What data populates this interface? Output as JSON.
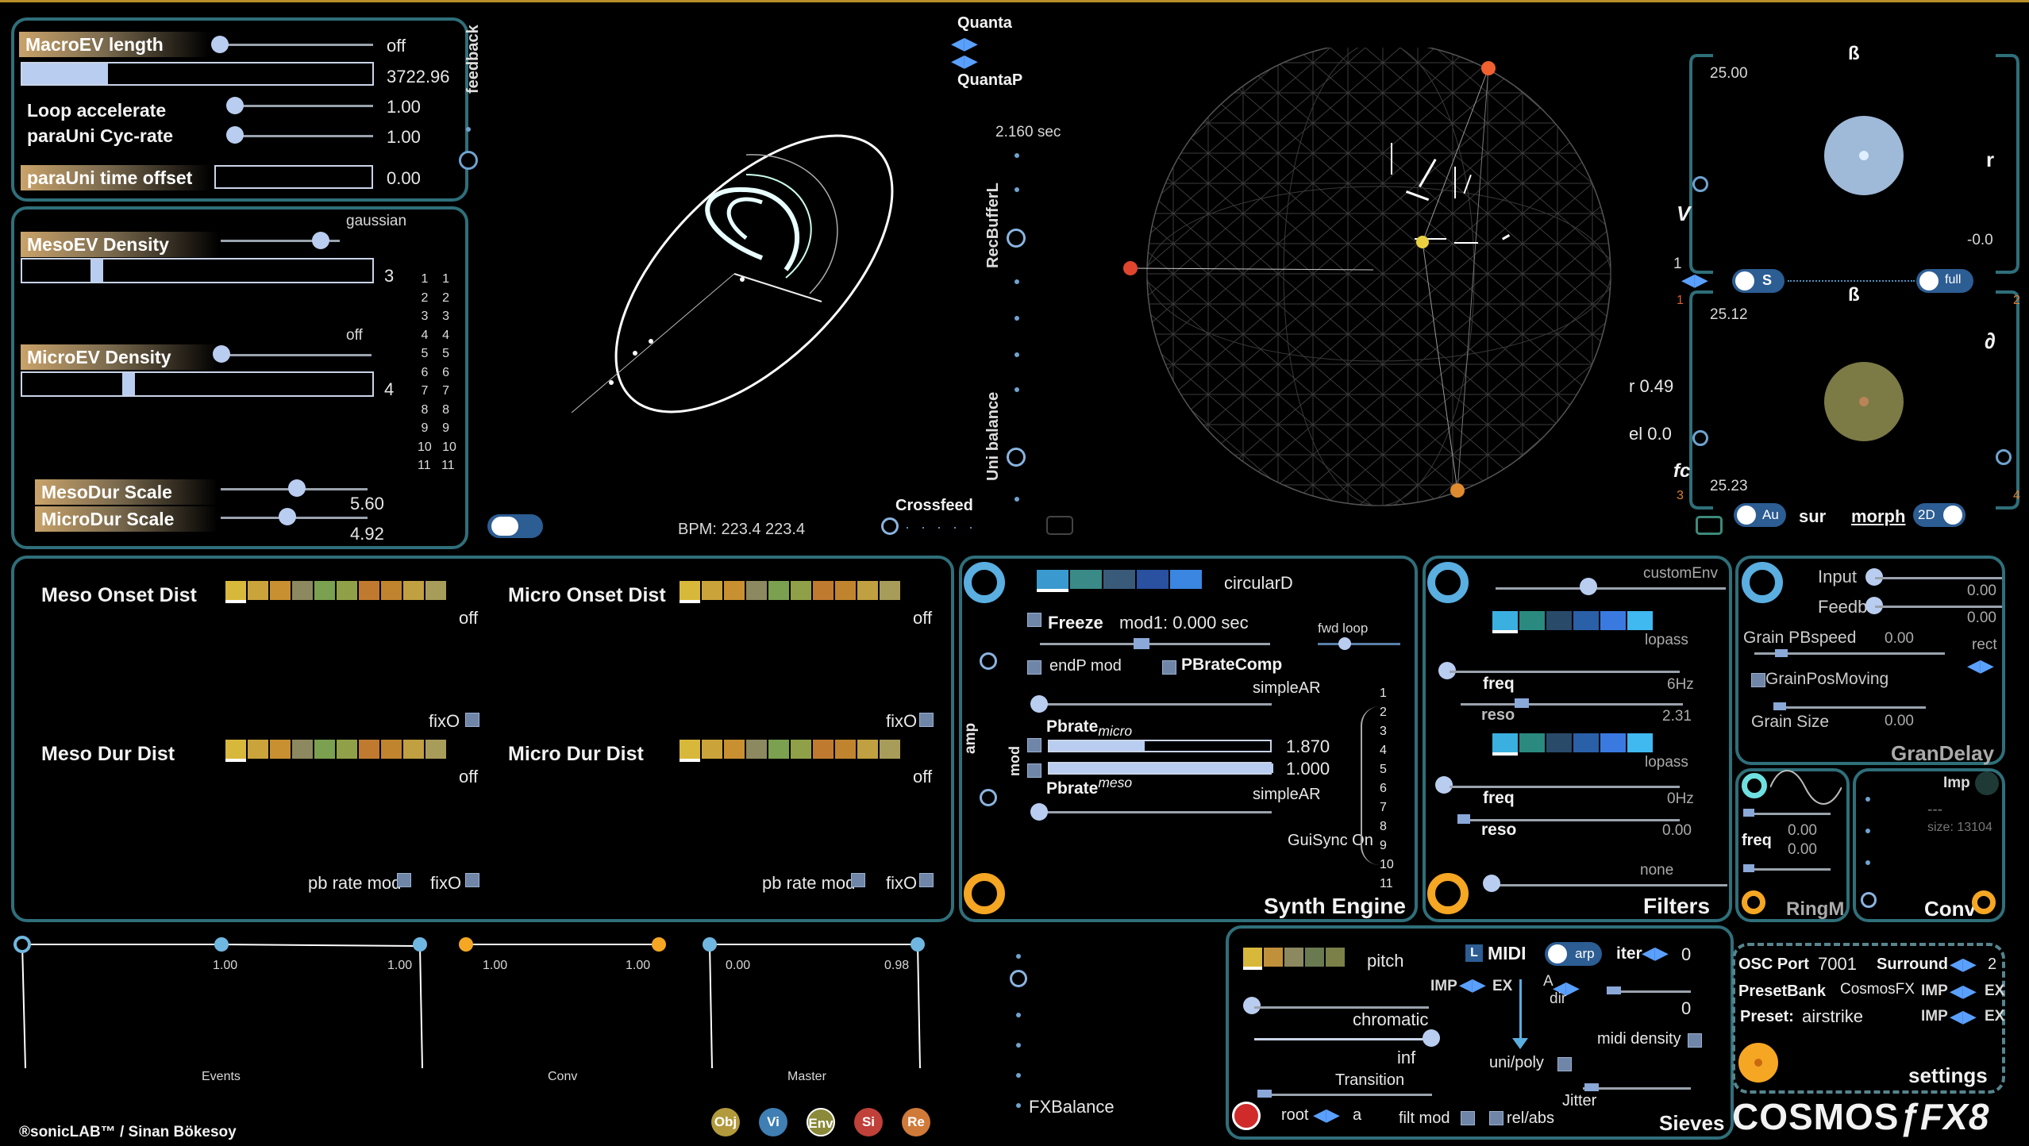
{
  "top": {
    "macroev_label": "MacroEV length",
    "macroev_state": "off",
    "macroev_value": "3722.96",
    "feedback_label": "feedback",
    "loop_accelerate_label": "Loop  accelerate",
    "loop_accelerate_value": "1.00",
    "parauni_cycrate_label": "paraUni  Cyc-rate",
    "parauni_cycrate_value": "1.00",
    "parauni_offset_label": "paraUni time offset",
    "parauni_offset_value": "0.00"
  },
  "density": {
    "meso_label": "MesoEV   Density",
    "meso_dist": "gaussian",
    "meso_value": "3",
    "micro_label": "MicroEV   Density",
    "micro_state": "off",
    "micro_value": "4",
    "meso_dur_label": "MesoDur   Scale",
    "meso_dur_value": "5.60",
    "micro_dur_label": "MicroDur   Scale",
    "micro_dur_value": "4.92",
    "index_col": [
      "1",
      "2",
      "3",
      "4",
      "5",
      "6",
      "7",
      "8",
      "9",
      "10",
      "11"
    ]
  },
  "center": {
    "bpm_label": "BPM: 223.4  223.4",
    "quanta": "Quanta",
    "quantap": "QuantaP",
    "recbuffer": "RecBufferL",
    "rec_time": "2.160 sec",
    "uni_balance": "Uni balance",
    "crossfeed": "Crossfeed"
  },
  "sphere": {
    "r": "r 0.49",
    "el": "el 0.0"
  },
  "xy": {
    "beta1": "ß",
    "r_axis": "r",
    "v_axis": "V",
    "top_val": "25.00",
    "neg_val": "-0.0",
    "one": "1",
    "s_btn": "S",
    "full_btn": "full",
    "n1": "1",
    "n2": "2",
    "beta2": "ß",
    "partial": "∂",
    "fc": "fc",
    "val2": "25.12",
    "val3": "25.23",
    "n3": "3",
    "n4": "4",
    "au": "Au",
    "sur": "sur",
    "morph": "morph",
    "twod": "2D"
  },
  "onset": {
    "meso_onset": "Meso Onset Dist",
    "micro_onset": "Micro Onset Dist",
    "meso_dur": "Meso Dur  Dist",
    "micro_dur": "Micro Dur Dist",
    "off": "off",
    "fixo": "fixO",
    "pb_rate_mod": "pb rate mod"
  },
  "synth": {
    "circular": "circularD",
    "freeze": "Freeze",
    "mod1": "mod1: 0.000 sec",
    "fwd_loop": "fwd loop",
    "endp": "endP mod",
    "pbratecomp": "PBrateComp",
    "simplear": "simpleAR",
    "pbrate_micro": "Pbrate",
    "micro_sub": "micro",
    "pbrate_meso": "Pbrate",
    "meso_sub": "meso",
    "micro_value": "1.870",
    "meso_value": "1.000",
    "amp": "amp",
    "mod": "mod",
    "guisync": "GuiSync On",
    "title": "Synth Engine",
    "nums": [
      "1",
      "2",
      "3",
      "4",
      "5",
      "6",
      "7",
      "8",
      "9",
      "10",
      "11"
    ]
  },
  "filters": {
    "customenv": "customEnv",
    "lopass": "lopass",
    "freq": "freq",
    "reso": "reso",
    "f1_freq": "6Hz",
    "f1_reso": "2.31",
    "f2_freq": "0Hz",
    "f2_reso": "0.00",
    "none": "none",
    "title": "Filters"
  },
  "grandelay": {
    "input": "Input",
    "feedb": "Feedb",
    "input_val": "0.00",
    "feedb_val": "0.00",
    "grain_pb": "Grain PBspeed",
    "grain_pb_val": "0.00",
    "rect": "rect",
    "grain_pos": "GrainPosMoving",
    "grain_size": "Grain Size",
    "grain_size_val": "0.00",
    "title": "GranDelay"
  },
  "ringm": {
    "freq": "freq",
    "v1": "0.00",
    "v2": "0.00",
    "title": "RingM"
  },
  "conv": {
    "imp": "Imp",
    "dashes": "---",
    "size": "size: 13104",
    "title": "Conv"
  },
  "env": {
    "v1": "1.00",
    "v2": "1.00",
    "v3": "1.00",
    "v4": "1.00",
    "v5": "0.00",
    "v6": "0.98",
    "events": "Events",
    "conv": "Conv",
    "master": "Master"
  },
  "sieves": {
    "pitch": "pitch",
    "midi": "MIDI",
    "arp": "arp",
    "iter": "iter",
    "iter_val": "0",
    "imp": "IMP",
    "ex": "EX",
    "a": "A",
    "dir": "dir",
    "zero": "0",
    "chromatic": "chromatic",
    "inf": "inf",
    "midi_density": "midi density",
    "transition": "Transition",
    "uni_poly": "uni/poly",
    "jitter": "Jitter",
    "root": "root",
    "root_val": "a",
    "filt_mod": "filt mod",
    "rel_abs": "rel/abs",
    "title": "Sieves",
    "l": "L"
  },
  "settings": {
    "osc_port": "OSC Port",
    "osc_val": "7001",
    "surround": "Surround",
    "surround_val": "2",
    "presetbank": "PresetBank",
    "presetbank_val": "CosmosFX",
    "imp": "IMP",
    "ex": "EX",
    "preset": "Preset:",
    "preset_val": "airstrike",
    "title": "settings"
  },
  "footer": {
    "fxbalance": "FXBalance",
    "credit": "®sonicLAB™ / Sinan Bökesoy",
    "logo_a": "COSMOS",
    "logo_b": "ƒFX8",
    "buttons": [
      "Obj",
      "Vi",
      "Env",
      "Si",
      "Re"
    ]
  },
  "colors": {
    "accent": "#2f6f7a",
    "knob": "#b9cdf0",
    "orange": "#f5a623",
    "blue_arrow": "#5aa0ff"
  }
}
